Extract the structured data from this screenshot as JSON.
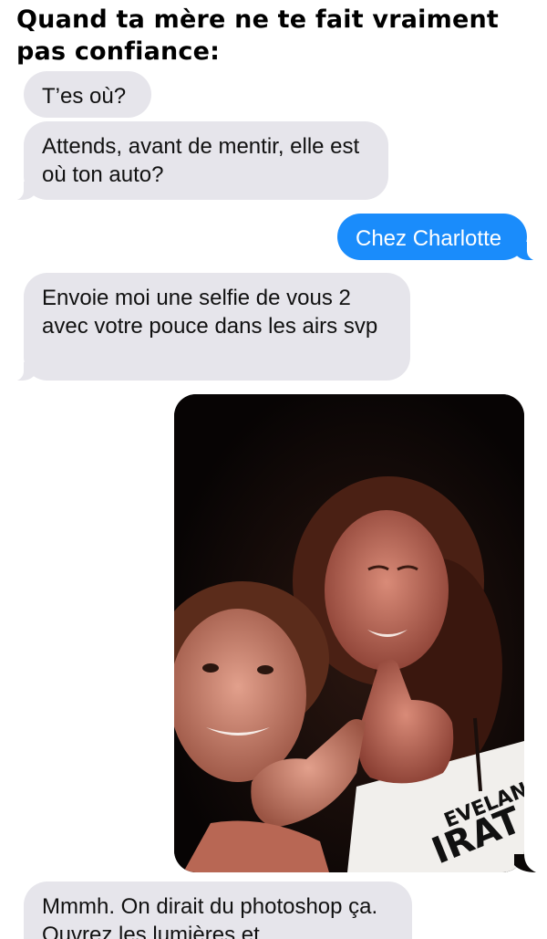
{
  "caption": {
    "line1": "Quand ta mère ne te fait vraiment",
    "line2": "pas confiance:"
  },
  "messages": [
    {
      "direction": "incoming",
      "text": "T’es où?"
    },
    {
      "direction": "incoming",
      "text": "Attends, avant de mentir, elle est où ton auto?"
    },
    {
      "direction": "outgoing",
      "text": "Chez Charlotte"
    },
    {
      "direction": "incoming",
      "text": "Envoie moi une selfie de vous 2 avec votre pouce dans les airs svp"
    },
    {
      "direction": "outgoing",
      "type": "photo",
      "depicts": "selfie-two-people-thumbs-up",
      "shirt_text": "EVELAN",
      "shirt_text_2": "IRAT"
    },
    {
      "direction": "incoming",
      "text": "Mmmh. On dirait du photoshop ça. Ouvrez les lumières et"
    }
  ],
  "colors": {
    "incoming_bubble": "#e6e5eb",
    "outgoing_bubble": "#1a8cfb",
    "background": "#ffffff"
  }
}
